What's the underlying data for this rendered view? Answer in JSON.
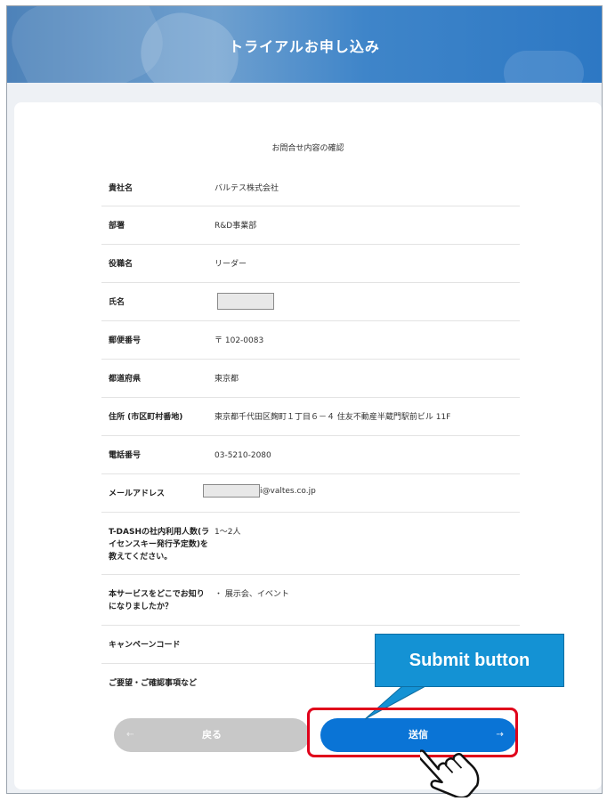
{
  "banner": {
    "title": "トライアルお申し込み"
  },
  "card": {
    "heading": "お問合せ内容の確認"
  },
  "rows": [
    {
      "label": "貴社名",
      "value": "バルテス株式会社"
    },
    {
      "label": "部署",
      "value": "R&D事業部"
    },
    {
      "label": "役職名",
      "value": "リーダー"
    },
    {
      "label": "氏名",
      "value": ""
    },
    {
      "label": "郵便番号",
      "value": "〒 102-0083"
    },
    {
      "label": "都道府県",
      "value": "東京都"
    },
    {
      "label": "住所 (市区町村番地)",
      "value": "東京都千代田区麹町１丁目６－４ 住友不動産半蔵門駅前ビル 11F"
    },
    {
      "label": "電話番号",
      "value": "03-5210-2080"
    },
    {
      "label": "メールアドレス",
      "value": "i@valtes.co.jp"
    },
    {
      "label": "T-DASHの社内利用人数(ライセンスキー発行予定数)を教えてください。",
      "value": "1～2人"
    },
    {
      "label": "本サービスをどこでお知りになりましたか？",
      "value": "・ 展示会、イベント"
    },
    {
      "label": "キャンペーンコード",
      "value": ""
    },
    {
      "label": "ご要望・ご確認事項など",
      "value": ""
    }
  ],
  "buttons": {
    "back_label": "戻る",
    "submit_label": "送信",
    "back_arrow": "⇠",
    "submit_arrow": "⇢"
  },
  "annotation": {
    "callout_text": "Submit button"
  },
  "colors": {
    "accent": "#0a74d6",
    "highlight": "#e0001a",
    "callout": "#1492d4",
    "back_button": "#c8c8c8"
  },
  "icons": {
    "pointer": "hand-pointer-icon"
  }
}
